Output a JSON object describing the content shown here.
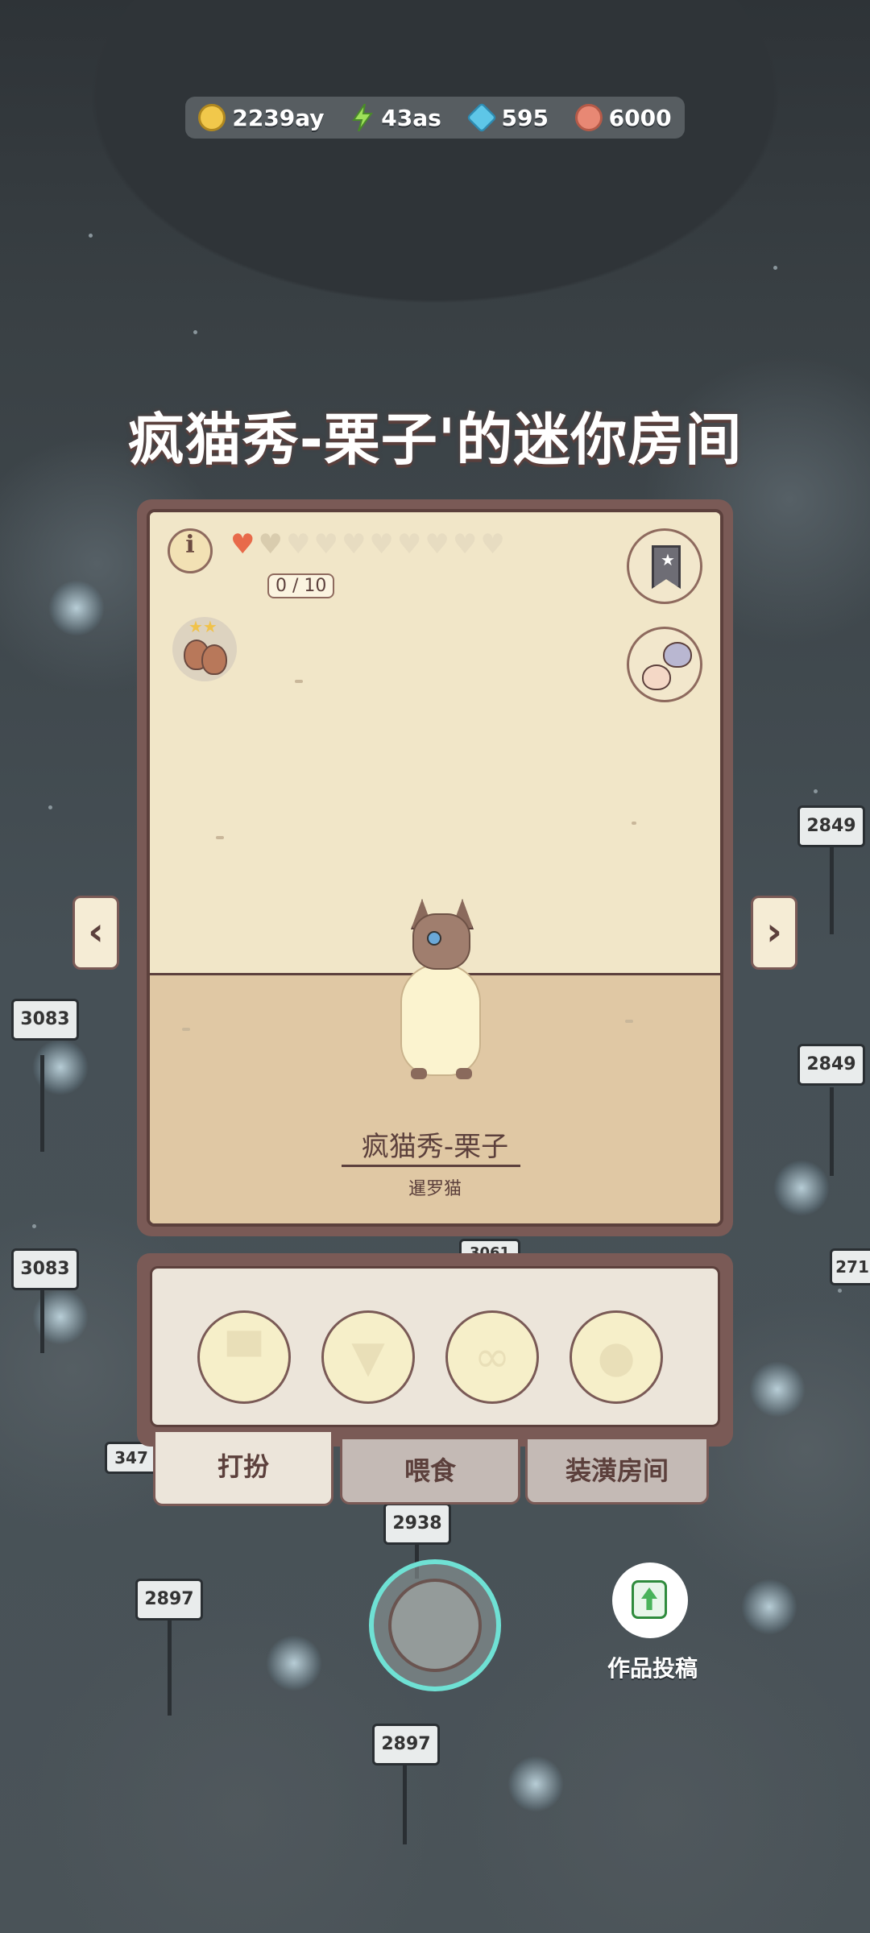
{
  "currency": {
    "coins": "2239ay",
    "energy": "43as",
    "gems": "595",
    "paw": "6000"
  },
  "title": "疯猫秀-栗子'的迷你房间",
  "room": {
    "love_progress": "0 / 10",
    "hearts_total": 10,
    "hearts_filled": 1,
    "pet_name": "疯猫秀-栗子",
    "pet_breed": "暹罗猫"
  },
  "slots": [
    {
      "icon": "hat-icon"
    },
    {
      "icon": "shirt-icon"
    },
    {
      "icon": "glasses-icon"
    },
    {
      "icon": "face-accessory-icon"
    }
  ],
  "tabs": {
    "dress": "打扮",
    "feed": "喂食",
    "decorate": "装潢房间"
  },
  "submit_label": "作品投稿",
  "background_signs": [
    "3083",
    "3083",
    "2849",
    "2849",
    "2938",
    "2897",
    "2897",
    "3061",
    "347",
    "271"
  ]
}
